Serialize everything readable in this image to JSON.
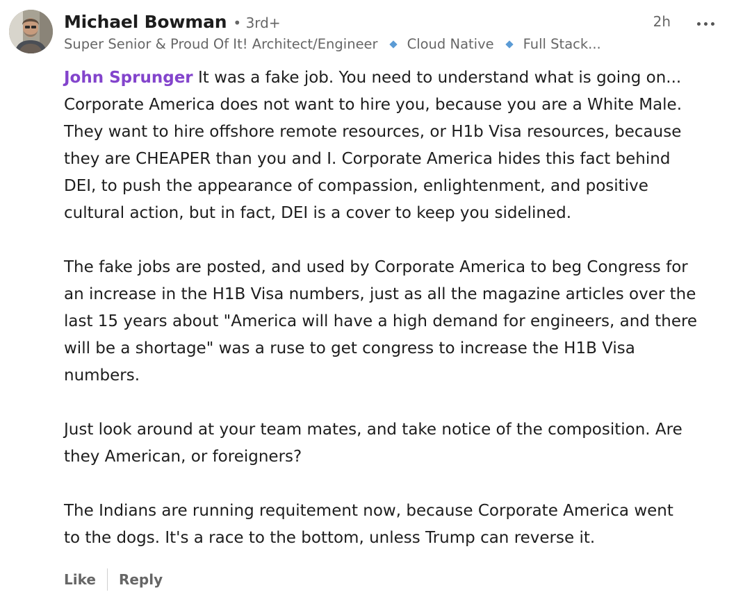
{
  "author": {
    "name": "Michael Bowman",
    "degree": "• 3rd+",
    "headline_parts": [
      "Super Senior & Proud Of It! Architect/Engineer",
      "Cloud Native",
      "Full Stack..."
    ]
  },
  "timestamp": "2h",
  "more_icon": "ellipsis-icon",
  "mention": "John Sprunger",
  "paragraphs": [
    [
      " It was a fake job. You need to understand what is going on...",
      "Corporate America does not want to hire you, because you are a White Male.",
      "They want to hire offshore remote resources, or H1b Visa resources, because",
      "they are CHEAPER than you and I. Corporate America hides this fact behind",
      "DEI, to push the appearance of compassion, enlightenment, and positive",
      "cultural action, but in fact, DEI is a cover to keep you sidelined."
    ],
    [
      "The fake jobs are posted, and used by Corporate America to beg Congress for",
      "an increase in the H1B Visa numbers, just as all the magazine articles over the",
      "last 15 years about \"America will have a high demand for engineers, and there",
      "will be a shortage\" was a ruse to get congress to increase the H1B Visa",
      "numbers."
    ],
    [
      "Just look around at your team mates, and take notice of the composition. Are",
      "they American, or foreigners?"
    ],
    [
      "The Indians are running requitement now, because Corporate America went",
      "to the dogs. It's a race to the bottom, unless Trump can reverse it."
    ]
  ],
  "actions": {
    "like_label": "Like",
    "reply_label": "Reply"
  },
  "colors": {
    "mention": "#8344cc",
    "muted": "#666666",
    "text": "#1d1d1d",
    "headline_separator": "#5b9bd5"
  }
}
